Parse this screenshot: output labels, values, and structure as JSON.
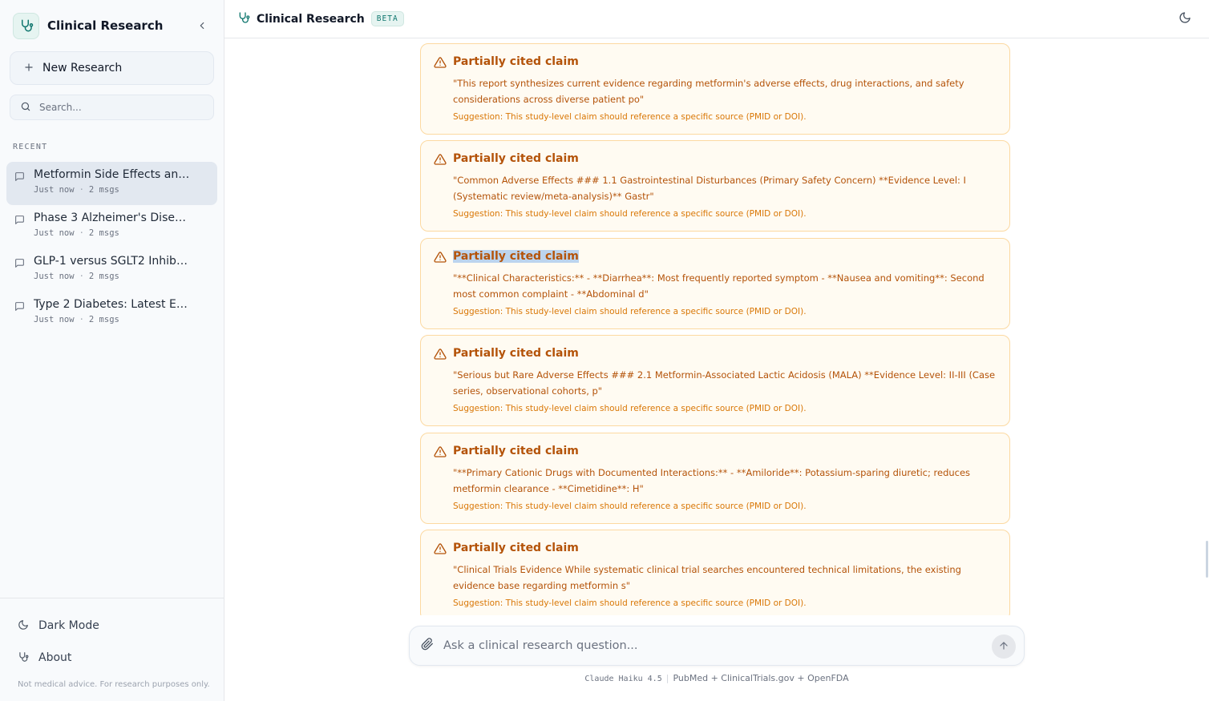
{
  "app": {
    "name": "Clinical Research",
    "badge": "BETA"
  },
  "sidebar": {
    "new_research": "New Research",
    "search_placeholder": "Search...",
    "recent_label": "RECENT",
    "chats": [
      {
        "title": "Metformin Side Effects and...",
        "time": "Just now",
        "count": "2 msgs",
        "active": true
      },
      {
        "title": "Phase 3 Alzheimer's Diseas...",
        "time": "Just now",
        "count": "2 msgs"
      },
      {
        "title": "GLP-1 versus SGLT2 Inhibit...",
        "time": "Just now",
        "count": "2 msgs"
      },
      {
        "title": "Type 2 Diabetes: Latest Evi...",
        "time": "Just now",
        "count": "2 msgs"
      }
    ],
    "dark_mode": "Dark Mode",
    "about": "About",
    "disclaimer": "Not medical advice. For research purposes only."
  },
  "cards": [
    {
      "title": "Partially cited claim",
      "quote": "\"This report synthesizes current evidence regarding metformin's adverse effects, drug interactions, and safety considerations across diverse patient po\"",
      "suggestion": "Suggestion: This study-level claim should reference a specific source (PMID or DOI)."
    },
    {
      "title": "Partially cited claim",
      "quote": "\"Common Adverse Effects ### 1.1 Gastrointestinal Disturbances (Primary Safety Concern) **Evidence Level: I (Systematic review/meta-analysis)** Gastr\"",
      "suggestion": "Suggestion: This study-level claim should reference a specific source (PMID or DOI)."
    },
    {
      "title": "Partially cited claim",
      "quote": "\"**Clinical Characteristics:** - **Diarrhea**: Most frequently reported symptom - **Nausea and vomiting**: Second most common complaint - **Abdominal d\"",
      "suggestion": "Suggestion: This study-level claim should reference a specific source (PMID or DOI)."
    },
    {
      "title": "Partially cited claim",
      "quote": "\"Serious but Rare Adverse Effects ### 2.1 Metformin-Associated Lactic Acidosis (MALA) **Evidence Level: II-III (Case series, observational cohorts, p\"",
      "suggestion": "Suggestion: This study-level claim should reference a specific source (PMID or DOI)."
    },
    {
      "title": "Partially cited claim",
      "quote": "\"**Primary Cationic Drugs with Documented Interactions:** - **Amiloride**: Potassium-sparing diuretic; reduces metformin clearance - **Cimetidine**: H\"",
      "suggestion": "Suggestion: This study-level claim should reference a specific source (PMID or DOI)."
    },
    {
      "title": "Partially cited claim",
      "quote": "\"Clinical Trials Evidence While systematic clinical trial searches encountered technical limitations, the existing evidence base regarding metformin s\"",
      "suggestion": "Suggestion: This study-level claim should reference a specific source (PMID or DOI)."
    }
  ],
  "composer": {
    "placeholder": "Ask a clinical research question..."
  },
  "footer": {
    "model": "Claude Haiku 4.5",
    "sources": "PubMed + ClinicalTrials.gov + OpenFDA"
  },
  "colors": {
    "accent": "#0f766e",
    "warning": "#b45309",
    "warning_bg": "#fffbf2",
    "warning_border": "#fcd9a1"
  },
  "icons": {
    "logo": "stethoscope-icon",
    "collapse": "chevron-left-icon",
    "new": "plus-icon",
    "search": "search-icon",
    "chat": "message-square-icon",
    "dark_mode": "moon-icon",
    "about": "stethoscope-icon",
    "warning": "alert-triangle-icon",
    "attach": "paperclip-icon",
    "send": "arrow-up-icon",
    "theme": "moon-icon"
  }
}
